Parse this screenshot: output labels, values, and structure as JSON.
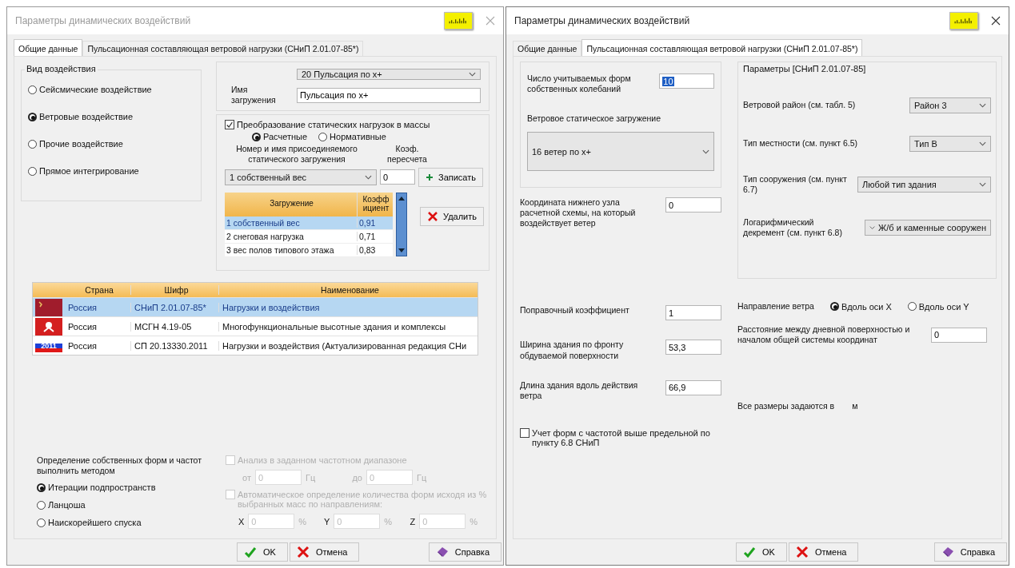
{
  "dialogs": [
    {
      "kind": "general",
      "title": "Параметры динамических воздействий",
      "active": false,
      "tabs": [
        {
          "label": "Общие данные",
          "selected": true
        },
        {
          "label": "Пульсационная составляющая ветровой нагрузки (СНиП 2.01.07-85*)",
          "selected": false
        }
      ],
      "action_type": {
        "title": "Вид воздействия",
        "options": [
          {
            "label": "Сейсмические воздействие",
            "selected": false
          },
          {
            "label": "Ветровые воздействие",
            "selected": true
          },
          {
            "label": "Прочие воздействие",
            "selected": false
          },
          {
            "label": "Прямое интегрирование",
            "selected": false
          }
        ]
      },
      "load": {
        "dropdown": "20 Пульсация по х+",
        "name_label": "Имя загружения",
        "name_value": "Пульсация по х+"
      },
      "mass": {
        "label": "Преобразование статических нагрузок в массы",
        "checked": true,
        "modes": [
          {
            "label": "Расчетные",
            "selected": true
          },
          {
            "label": "Нормативные",
            "selected": false
          }
        ],
        "number_label": "Номер и имя присоединяемого статического загружения",
        "coef_label": "Коэф. пересчета",
        "dropdown": "1 собственный вес",
        "coef_value": "0",
        "add_button": "Записать",
        "delete_button": "Удалить",
        "columns": [
          "Загружение",
          "Коэфф ициент"
        ],
        "rows": [
          {
            "load": "1 собственный вес",
            "coef": "0,91",
            "selected": true
          },
          {
            "load": "2 снеговая нагрузка",
            "coef": "0,71",
            "selected": false
          },
          {
            "load": "3 вес полов типового этажа",
            "coef": "0,83",
            "selected": false
          }
        ]
      },
      "norms": {
        "columns": [
          "Страна",
          "Шифр",
          "Наименование"
        ],
        "rows": [
          {
            "kind": "ussr",
            "country": "Россия",
            "code": "СНиП 2.01.07-85*",
            "name": "Нагрузки и воздействия",
            "selected": true
          },
          {
            "kind": "moscow",
            "country": "Россия",
            "code": "МСГН 4.19-05",
            "name": "Многофункциональные высотные здания и комплексы",
            "selected": false
          },
          {
            "kind": "russia",
            "flag_text": "2011",
            "country": "Россия",
            "code": "СП 20.13330.2011",
            "name": "Нагрузки и воздействия (Актуализированная редакция СНи",
            "selected": false
          }
        ]
      },
      "method": {
        "label": "Определение собственных форм и частот выполнить методом",
        "options": [
          {
            "label": "Итерации подпространств",
            "selected": true
          },
          {
            "label": "Ланцоша",
            "selected": false
          },
          {
            "label": "Наискорейшего спуска",
            "selected": false
          }
        ]
      },
      "frequency": {
        "disabled": true,
        "range_label": "Анализ в заданном частотном диапазоне",
        "range_checked": false,
        "from_label": "от",
        "from_value": "0",
        "from_unit": "Гц",
        "to_label": "до",
        "to_value": "0",
        "to_unit": "Гц",
        "auto_label": "Автоматическое определение количества форм исходя из % выбранных масс по направлениям:",
        "auto_checked": false,
        "axes": [
          {
            "label": "X",
            "value": "0",
            "unit": "%"
          },
          {
            "label": "Y",
            "value": "0",
            "unit": "%"
          },
          {
            "label": "Z",
            "value": "0",
            "unit": "%"
          }
        ]
      },
      "buttons": [
        {
          "kind": "ok",
          "label": "OK"
        },
        {
          "kind": "cancel",
          "label": "Отмена"
        },
        {
          "kind": "help",
          "label": "Справка"
        }
      ]
    },
    {
      "kind": "wind",
      "title": "Параметры динамических воздействий",
      "active": true,
      "tabs": [
        {
          "label": "Общие данные",
          "selected": false
        },
        {
          "label": "Пульсационная составляющая ветровой нагрузки (СНиП 2.01.07-85*)",
          "selected": true
        }
      ],
      "modes_label": "Число учитываемых форм собственных колебаний",
      "modes_value": "10",
      "modes_highlighted": true,
      "static_label": "Ветровое статическое загружение",
      "static_value": "16  ветер по х+",
      "node_label": "Координата нижнего узла расчетной схемы, на который воздействует ветер",
      "node_value": "0",
      "fields": [
        {
          "label": "Поправочный коэффициент",
          "value": "1"
        },
        {
          "label": "Ширина здания по фронту обдуваемой поверхности",
          "value": "53,3"
        },
        {
          "label": "Длина здания вдоль действия ветра",
          "value": "66,9"
        }
      ],
      "check": {
        "label": "Учет форм с частотой выше предельной по пункту 6.8 СНиП",
        "checked": false
      },
      "params": {
        "title": "Параметры [СНиП 2.01.07-85]",
        "items": [
          {
            "label": "Ветровой район (см. табл. 5)",
            "value": "Район 3",
            "kind": "short"
          },
          {
            "label": "Тип местности (см. пункт 6.5)",
            "value": "Тип B",
            "kind": "short"
          },
          {
            "label": "Тип сооружения (см. пункт 6.7)",
            "value": "Любой тип здания",
            "kind": "wide"
          },
          {
            "label": "Логарифмический декремент (см. пункт 6.8)",
            "value": "Ж/б и каменные сооружен",
            "kind": "left-caret"
          }
        ]
      },
      "direction": {
        "label": "Направление ветра",
        "options": [
          {
            "label": "Вдоль оси X",
            "selected": true
          },
          {
            "label": "Вдоль оси Y",
            "selected": false
          }
        ]
      },
      "distance": {
        "label": "Расстояние между дневной поверхностью и началом общей системы координат",
        "value": "0"
      },
      "units": {
        "label": "Все размеры задаются в",
        "unit": "м"
      },
      "buttons": [
        {
          "kind": "ok",
          "label": "OK"
        },
        {
          "kind": "cancel",
          "label": "Отмена"
        },
        {
          "kind": "help",
          "label": "Справка"
        }
      ]
    }
  ]
}
